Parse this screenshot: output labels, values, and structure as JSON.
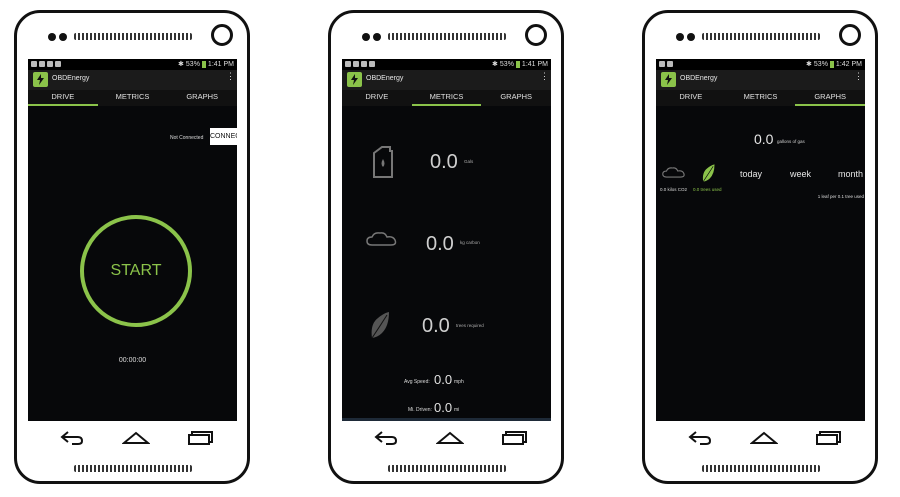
{
  "status_time_1": "1:41 PM",
  "status_time_2": "1:41 PM",
  "status_time_3": "1:42 PM",
  "battery": "53%",
  "app_title": "OBDEnergy",
  "tabs": [
    "DRIVE",
    "METRICS",
    "GRAPHS"
  ],
  "drive": {
    "status_text": "Not Connected",
    "connect_label": "CONNECT",
    "start_label": "START",
    "timer": "00:00:00"
  },
  "metrics": {
    "gals_value": "0.0",
    "gals_unit": "Gals",
    "carbon_value": "0.0",
    "carbon_unit": "kg carbon",
    "trees_value": "0.0",
    "trees_unit": "trees required",
    "avg_speed_label": "Avg Speed:",
    "avg_speed_value": "0.0",
    "avg_speed_unit": "mph",
    "mi_driven_label": "Mi. Driven:",
    "mi_driven_value": "0.0",
    "mi_driven_unit": "mi"
  },
  "graphs": {
    "gas_value": "0.0",
    "gas_unit": "gallons of gas",
    "periods": [
      "today",
      "week",
      "month"
    ],
    "co2_label": "0.0 kilos CO2",
    "trees_label": "0.0 trees used",
    "footnote": "1 leaf per 0.1 tree used"
  },
  "accent_color": "#8bc34a"
}
